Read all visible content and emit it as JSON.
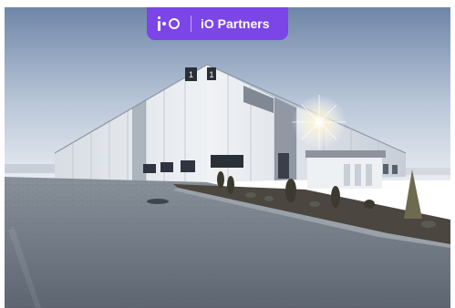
{
  "badge": {
    "brand_name": "iO Partners",
    "logo_icon": "io-logo-icon",
    "color": "#7B45E8"
  },
  "photo": {
    "building_numbers": [
      "1",
      "1"
    ]
  }
}
